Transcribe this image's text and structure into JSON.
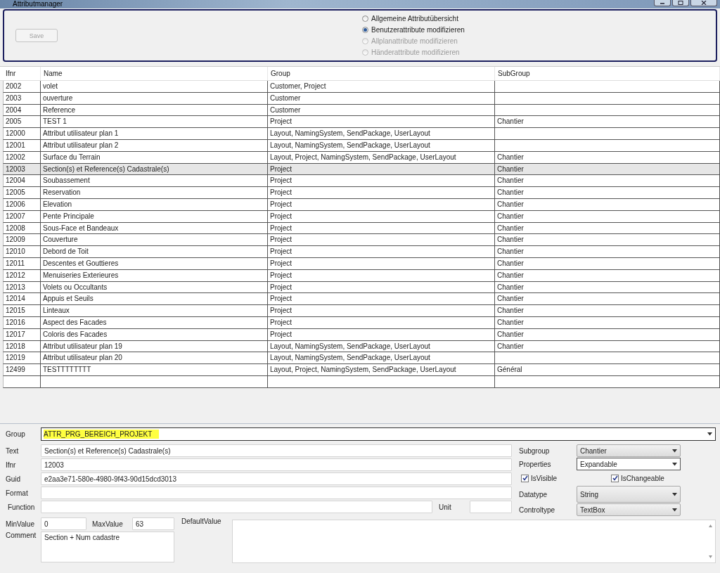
{
  "window": {
    "title": "Attributmanager"
  },
  "toolbar": {
    "save_button": {
      "label": "Save",
      "disabled": true
    },
    "modes": [
      {
        "label": "Allgemeine Attributübersicht",
        "selected": false,
        "disabled": false
      },
      {
        "label": "Benutzerattribute modifizieren",
        "selected": true,
        "disabled": false
      },
      {
        "label": "Allplanattribute modifizieren",
        "selected": false,
        "disabled": true
      },
      {
        "label": "Händerattribute modifizieren",
        "selected": false,
        "disabled": true
      }
    ]
  },
  "table": {
    "columns": [
      "Ifnr",
      "Name",
      "Group",
      "SubGroup"
    ],
    "rows": [
      {
        "cells": [
          "2002",
          "volet",
          "Customer, Project",
          ""
        ],
        "selected": false
      },
      {
        "cells": [
          "2003",
          "ouverture",
          "Customer",
          ""
        ],
        "selected": false
      },
      {
        "cells": [
          "2004",
          "Reference",
          "Customer",
          ""
        ],
        "selected": false
      },
      {
        "cells": [
          "2005",
          "TEST 1",
          "Project",
          "Chantier"
        ],
        "selected": false
      },
      {
        "cells": [
          "12000",
          "Attribut utilisateur plan 1",
          "Layout, NamingSystem, SendPackage, UserLayout",
          ""
        ],
        "selected": false
      },
      {
        "cells": [
          "12001",
          "Attribut utilisateur plan 2",
          "Layout, NamingSystem, SendPackage, UserLayout",
          ""
        ],
        "selected": false
      },
      {
        "cells": [
          "12002",
          "Surface du Terrain",
          "Layout, Project, NamingSystem, SendPackage, UserLayout",
          "Chantier"
        ],
        "selected": false
      },
      {
        "cells": [
          "12003",
          "Section(s) et Reference(s) Cadastrale(s)",
          "Project",
          "Chantier"
        ],
        "selected": true
      },
      {
        "cells": [
          "12004",
          "Soubassement",
          "Project",
          "Chantier"
        ],
        "selected": false
      },
      {
        "cells": [
          "12005",
          "Reservation",
          "Project",
          "Chantier"
        ],
        "selected": false
      },
      {
        "cells": [
          "12006",
          "Elevation",
          "Project",
          "Chantier"
        ],
        "selected": false
      },
      {
        "cells": [
          "12007",
          "Pente Principale",
          "Project",
          "Chantier"
        ],
        "selected": false
      },
      {
        "cells": [
          "12008",
          "Sous-Face et Bandeaux",
          "Project",
          "Chantier"
        ],
        "selected": false
      },
      {
        "cells": [
          "12009",
          "Couverture",
          "Project",
          "Chantier"
        ],
        "selected": false
      },
      {
        "cells": [
          "12010",
          "Debord de Toit",
          "Project",
          "Chantier"
        ],
        "selected": false
      },
      {
        "cells": [
          "12011",
          "Descentes et Gouttieres",
          "Project",
          "Chantier"
        ],
        "selected": false
      },
      {
        "cells": [
          "12012",
          "Menuiseries Exterieures",
          "Project",
          "Chantier"
        ],
        "selected": false
      },
      {
        "cells": [
          "12013",
          "Volets ou Occultants",
          "Project",
          "Chantier"
        ],
        "selected": false
      },
      {
        "cells": [
          "12014",
          "Appuis et Seuils",
          "Project",
          "Chantier"
        ],
        "selected": false
      },
      {
        "cells": [
          "12015",
          "Linteaux",
          "Project",
          "Chantier"
        ],
        "selected": false
      },
      {
        "cells": [
          "12016",
          "Aspect des Facades",
          "Project",
          "Chantier"
        ],
        "selected": false
      },
      {
        "cells": [
          "12017",
          "Coloris des Facades",
          "Project",
          "Chantier"
        ],
        "selected": false
      },
      {
        "cells": [
          "12018",
          "Attribut utilisateur plan 19",
          "Layout, NamingSystem, SendPackage, UserLayout",
          "Chantier"
        ],
        "selected": false
      },
      {
        "cells": [
          "12019",
          "Attribut utilisateur plan 20",
          "Layout, NamingSystem, SendPackage, UserLayout",
          ""
        ],
        "selected": false
      },
      {
        "cells": [
          "12499",
          "TESTTTTTTTT",
          "Layout, Project, NamingSystem, SendPackage, UserLayout",
          "Général"
        ],
        "selected": false
      }
    ]
  },
  "form": {
    "group": {
      "label": "Group",
      "value": "ATTR_PRG_BEREICH_PROJEKT",
      "highlighted": true
    },
    "fields": [
      {
        "label": "Text",
        "value": "Section(s) et Reference(s) Cadastrale(s)"
      },
      {
        "label": "Ifnr",
        "value": "12003"
      },
      {
        "label": "Guid",
        "value": "e2aa3e71-580e-4980-9f43-90d15dcd3013"
      },
      {
        "label": "Format"
      },
      {
        "label": "Function"
      }
    ],
    "unit": {
      "label": "Unit"
    },
    "right": [
      {
        "kind": "dropdown",
        "label": "Subgroup",
        "value": "Chantier",
        "focused": false
      },
      {
        "kind": "dropdown",
        "label": "Properties",
        "value": "Expandable",
        "focused": true
      },
      {
        "kind": "checks",
        "items": [
          {
            "label": "IsVisible",
            "checked": true
          },
          {
            "label": "IsChangeable",
            "checked": true
          }
        ]
      },
      {
        "kind": "dropdown",
        "label": "Datatype",
        "value": "String",
        "focused": false
      },
      {
        "kind": "dropdown",
        "label": "Controltype",
        "value": "TextBox",
        "focused": false
      }
    ],
    "min": {
      "label": "MinValue",
      "value": "0"
    },
    "max": {
      "label": "MaxValue",
      "value": "63"
    },
    "default": {
      "label": "DefaultValue"
    },
    "comment": {
      "label": "Comment",
      "value": "Section + Num cadastre"
    }
  }
}
